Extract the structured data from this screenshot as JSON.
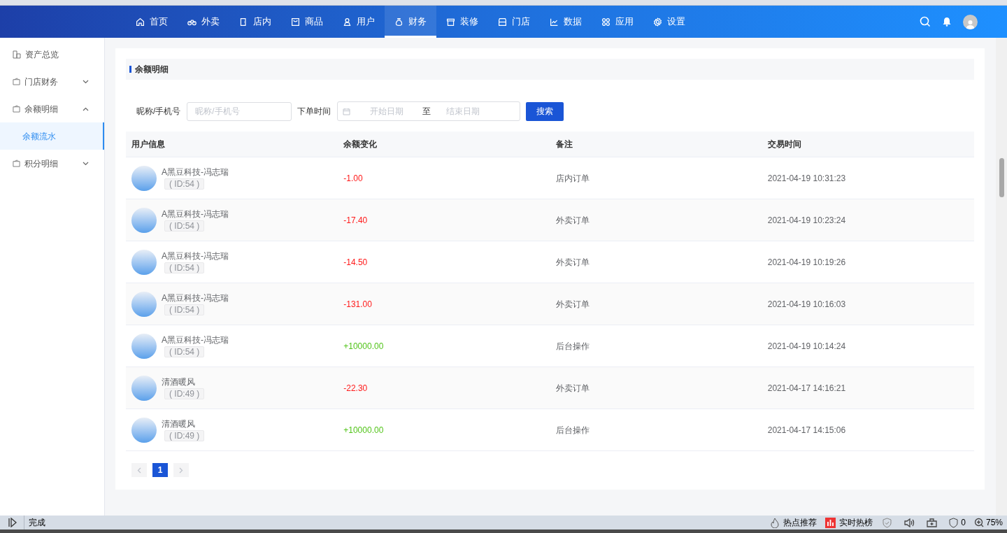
{
  "nav": {
    "items": [
      {
        "label": "首页",
        "selected": false
      },
      {
        "label": "外卖",
        "selected": false
      },
      {
        "label": "店内",
        "selected": false
      },
      {
        "label": "商品",
        "selected": false
      },
      {
        "label": "用户",
        "selected": false
      },
      {
        "label": "财务",
        "selected": true
      },
      {
        "label": "装修",
        "selected": false
      },
      {
        "label": "门店",
        "selected": false
      },
      {
        "label": "数据",
        "selected": false
      },
      {
        "label": "应用",
        "selected": false
      },
      {
        "label": "设置",
        "selected": false
      }
    ]
  },
  "sidebar": {
    "items": [
      {
        "label": "资产总览",
        "kind": "link",
        "selected": false
      },
      {
        "label": "门店财务",
        "kind": "group",
        "expanded": false
      },
      {
        "label": "余额明细",
        "kind": "group",
        "expanded": true,
        "children": [
          {
            "label": "余额流水",
            "selected": true
          }
        ]
      },
      {
        "label": "积分明细",
        "kind": "group",
        "expanded": false
      }
    ]
  },
  "panel": {
    "title": "余额明细"
  },
  "filters": {
    "keyword_label": "昵称/手机号",
    "keyword": {
      "placeholder": "昵称/手机号"
    },
    "time_label": "下单时间",
    "start": {
      "placeholder": "开始日期"
    },
    "separator": "至",
    "end": {
      "placeholder": "结束日期"
    },
    "search_button": "搜索"
  },
  "table": {
    "columns": [
      "用户信息",
      "余额变化",
      "备注",
      "交易时间"
    ],
    "rows": [
      {
        "name": "A黑豆科技-冯志瑞",
        "id": "( ID:54 )",
        "amount": "-1.00",
        "kind": "debit",
        "note": "店内订单",
        "time": "2021-04-19 10:31:23"
      },
      {
        "name": "A黑豆科技-冯志瑞",
        "id": "( ID:54 )",
        "amount": "-17.40",
        "kind": "debit",
        "note": "外卖订单",
        "time": "2021-04-19 10:23:24"
      },
      {
        "name": "A黑豆科技-冯志瑞",
        "id": "( ID:54 )",
        "amount": "-14.50",
        "kind": "debit",
        "note": "外卖订单",
        "time": "2021-04-19 10:19:26"
      },
      {
        "name": "A黑豆科技-冯志瑞",
        "id": "( ID:54 )",
        "amount": "-131.00",
        "kind": "debit",
        "note": "外卖订单",
        "time": "2021-04-19 10:16:03"
      },
      {
        "name": "A黑豆科技-冯志瑞",
        "id": "( ID:54 )",
        "amount": "+10000.00",
        "kind": "credit",
        "note": "后台操作",
        "time": "2021-04-19 10:14:24"
      },
      {
        "name": "清酒暖风",
        "id": "( ID:49 )",
        "amount": "-22.30",
        "kind": "debit",
        "note": "外卖订单",
        "time": "2021-04-17 14:16:21"
      },
      {
        "name": "清酒暖风",
        "id": "( ID:49 )",
        "amount": "+10000.00",
        "kind": "credit",
        "note": "后台操作",
        "time": "2021-04-17 14:15:06"
      }
    ]
  },
  "pagination": {
    "pages": [
      {
        "label": "1",
        "selected": true
      }
    ]
  },
  "status_bar": {
    "text": "完成",
    "hot": "热点推荐",
    "trending": "实时热榜",
    "ad_count": "0",
    "zoom": "75%"
  }
}
